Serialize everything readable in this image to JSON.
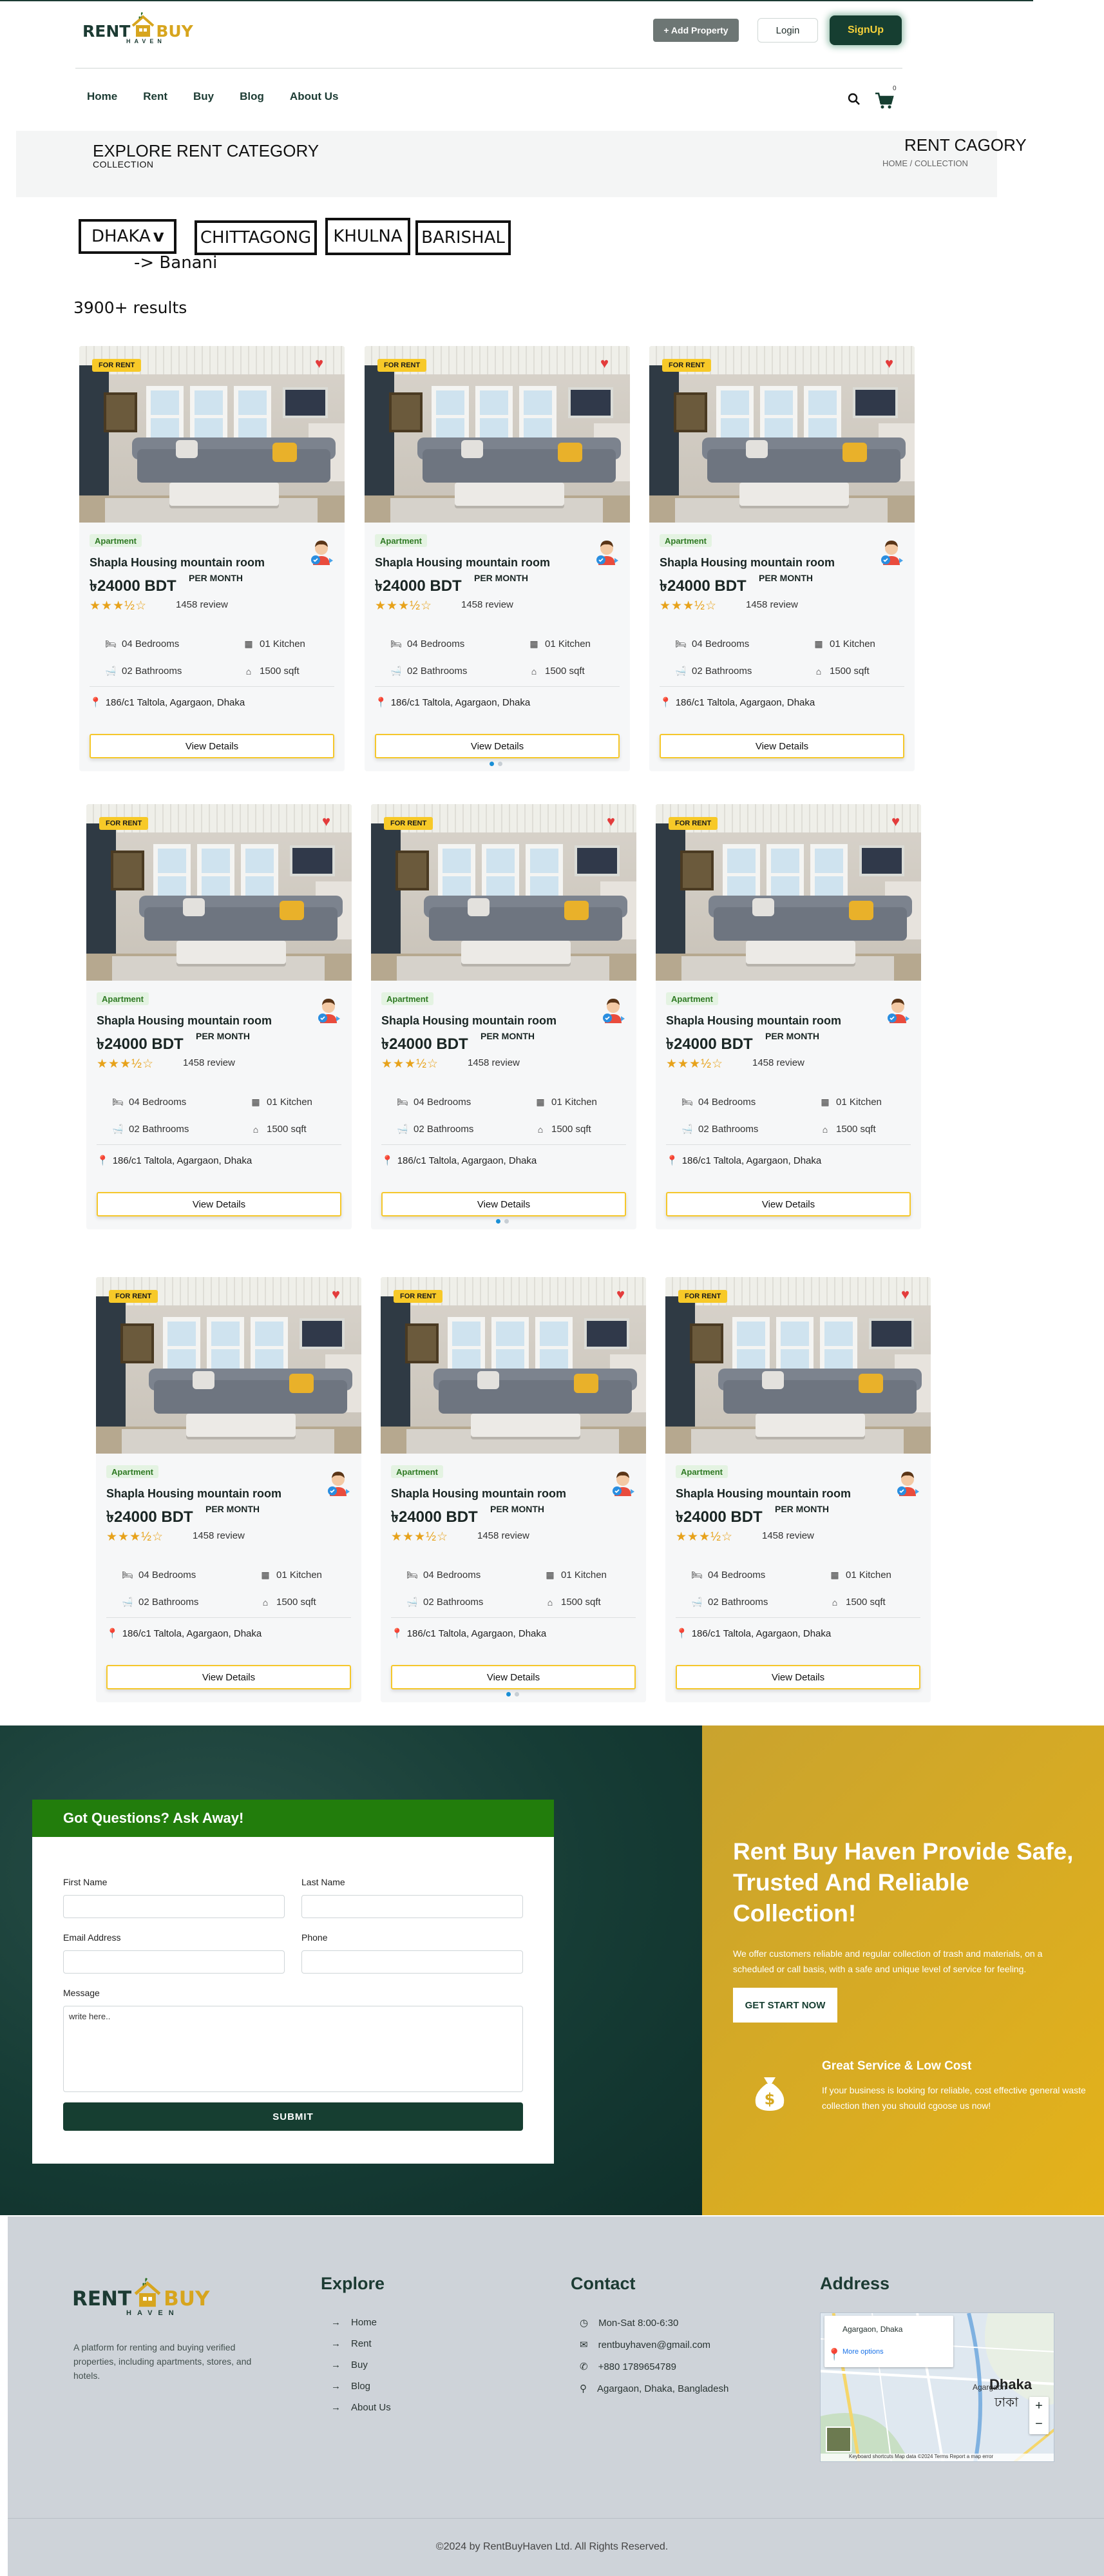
{
  "header": {
    "logo_word1": "RENT",
    "logo_word2": "BUY",
    "logo_sub": "HAVEN",
    "add_property": "+ Add Property",
    "login": "Login",
    "signup": "SignUp",
    "cart_count": "0",
    "nav": [
      "Home",
      "Rent",
      "Buy",
      "Blog",
      "About Us"
    ]
  },
  "banner": {
    "title": "EXPLORE RENT CATEGORY",
    "subtitle": "COLLECTION",
    "right_title": "RENT CAGORY",
    "breadcrumb_home": "HOME",
    "breadcrumb_sep": "/",
    "breadcrumb_current": "COLLECTION"
  },
  "filters": {
    "cities": [
      "DHAKA",
      "CHITTAGONG",
      "KHULNA",
      "BARISHAL"
    ],
    "dropdown_arrow": "v",
    "sub_location": "-> Banani",
    "results": "3900+ results"
  },
  "card": {
    "badge": "FOR RENT",
    "type": "Apartment",
    "title": "Shapla Housing mountain room",
    "price": "৳24000 BDT",
    "per": "PER MONTH",
    "stars": "★★★½☆",
    "rating": 3.5,
    "review": "1458 review",
    "bedrooms": "04 Bedrooms",
    "kitchen": "01 Kitchen",
    "bathrooms": "02 Bathrooms",
    "sqft": "1500 sqft",
    "address": "186/c1 Taltola, Agargaon, Dhaka",
    "button": "View Details"
  },
  "contact": {
    "form_title": "Got Questions? Ask Away!",
    "first_name": "First Name",
    "last_name": "Last Name",
    "email": "Email Address",
    "phone": "Phone",
    "message": "Message",
    "message_placeholder": "write here..",
    "submit": "SUBMIT",
    "promo_title": "Rent Buy Haven Provide Safe, Trusted And Reliable Collection!",
    "promo_text": "We offer customers reliable and regular collection of trash and materials, on a scheduled or call basis, with a safe and unique level of service for feeling.",
    "promo_button": "GET START NOW",
    "service_title": "Great Service & Low Cost",
    "service_text": "If your business is looking for reliable, cost effective general waste collection then you should cgoose us now!"
  },
  "footer": {
    "about": "A platform for renting and buying verified properties, including apartments, stores, and hotels.",
    "explore_title": "Explore",
    "explore": [
      "Home",
      "Rent",
      "Buy",
      "Blog",
      "About Us"
    ],
    "contact_title": "Contact",
    "contact": [
      "Mon-Sat 8:00-6:30",
      "rentbuyhaven@gmail.com",
      "+880 1789654789",
      "Agargaon, Dhaka, Bangladesh"
    ],
    "address_title": "Address",
    "map_place": "Agargaon, Dhaka",
    "map_more": "More options",
    "map_city": "Dhaka",
    "map_city_bn": "ঢাকা",
    "map_pin": "Agargaon",
    "map_footer": "Keyboard shortcuts   Map data ©2024   Terms   Report a map error",
    "copyright": "©2024 by RentBuyHaven Ltd. All Rights Reserved."
  }
}
